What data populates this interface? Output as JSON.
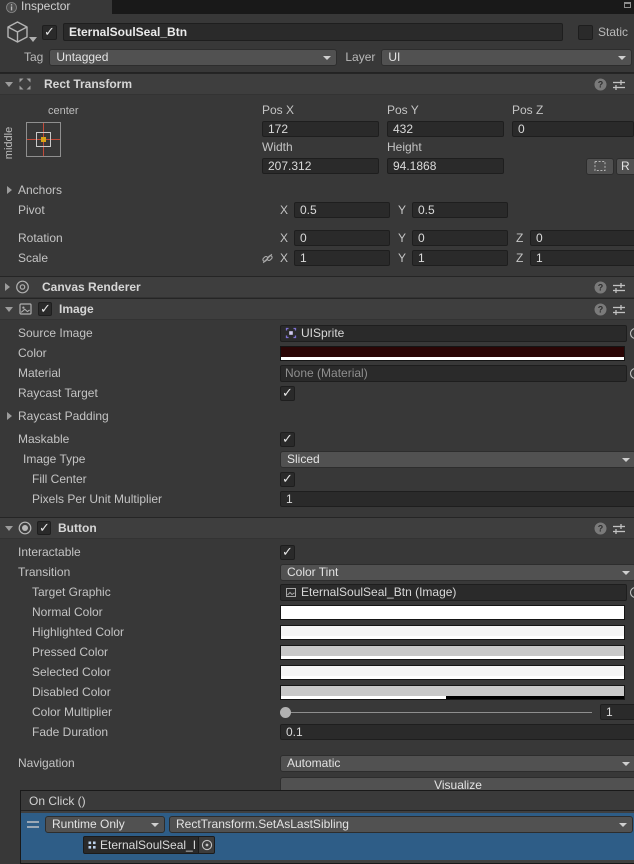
{
  "tab": {
    "title": "Inspector"
  },
  "gameobject": {
    "name": "EternalSoulSeal_Btn",
    "static_label": "Static",
    "tag_label": "Tag",
    "tag_value": "Untagged",
    "layer_label": "Layer",
    "layer_value": "UI"
  },
  "rect_transform": {
    "title": "Rect Transform",
    "anchor": {
      "horizontal": "center",
      "vertical": "middle"
    },
    "fields": {
      "pos_x_label": "Pos X",
      "pos_y_label": "Pos Y",
      "pos_z_label": "Pos Z",
      "pos_x": "172",
      "pos_y": "432",
      "pos_z": "0",
      "width_label": "Width",
      "height_label": "Height",
      "width": "207.312",
      "height": "94.1868"
    },
    "anchors_label": "Anchors",
    "pivot_label": "Pivot",
    "pivot_x": "0.5",
    "pivot_y": "0.5",
    "rotation_label": "Rotation",
    "rotation_x": "0",
    "rotation_y": "0",
    "rotation_z": "0",
    "scale_label": "Scale",
    "scale_x": "1",
    "scale_y": "1",
    "scale_z": "1",
    "axis_x": "X",
    "axis_y": "Y",
    "axis_z": "Z",
    "raw_edit_label": "R"
  },
  "canvas_renderer": {
    "title": "Canvas Renderer"
  },
  "image": {
    "title": "Image",
    "source_image_label": "Source Image",
    "source_image_value": "UISprite",
    "color_label": "Color",
    "color_hex": "#2a0505",
    "color_alpha_percent": "100%",
    "material_label": "Material",
    "material_value": "None (Material)",
    "raycast_target_label": "Raycast Target",
    "raycast_padding_label": "Raycast Padding",
    "maskable_label": "Maskable",
    "image_type_label": "Image Type",
    "image_type_value": "Sliced",
    "fill_center_label": "Fill Center",
    "ppu_label": "Pixels Per Unit Multiplier",
    "ppu_value": "1"
  },
  "button": {
    "title": "Button",
    "interactable_label": "Interactable",
    "transition_label": "Transition",
    "transition_value": "Color Tint",
    "target_graphic_label": "Target Graphic",
    "target_graphic_value": "EternalSoulSeal_Btn (Image)",
    "colors": [
      {
        "label": "Normal Color",
        "hex": "#FFFFFF",
        "alpha_percent": "100%"
      },
      {
        "label": "Highlighted Color",
        "hex": "#F5F5F5",
        "alpha_percent": "100%"
      },
      {
        "label": "Pressed Color",
        "hex": "#C8C8C8",
        "alpha_percent": "100%"
      },
      {
        "label": "Selected Color",
        "hex": "#F5F5F5",
        "alpha_percent": "100%"
      },
      {
        "label": "Disabled Color",
        "hex": "#C8C8C8",
        "alpha_percent": "48%"
      }
    ],
    "color_multiplier_label": "Color Multiplier",
    "color_multiplier_value": "1",
    "fade_duration_label": "Fade Duration",
    "fade_duration_value": "0.1",
    "navigation_label": "Navigation",
    "navigation_value": "Automatic",
    "visualize_label": "Visualize"
  },
  "on_click": {
    "title": "On Click ()",
    "row": {
      "mode": "Runtime Only",
      "function": "RectTransform.SetAsLastSibling",
      "target": "EternalSoulSeal_Image (R"
    },
    "selected_row_color": "#2e5d87"
  }
}
